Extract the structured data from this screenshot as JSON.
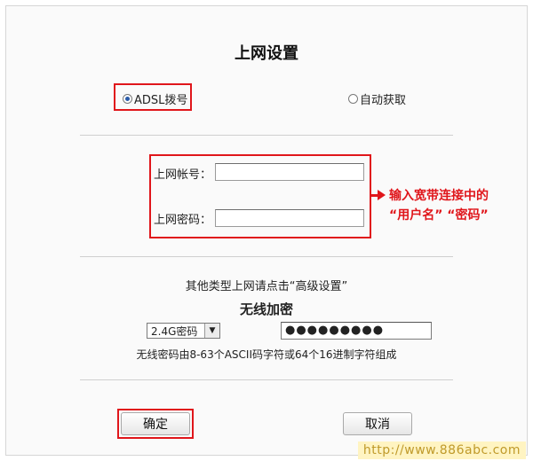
{
  "title": "上网设置",
  "mode": {
    "options": [
      {
        "label": "ADSL拨号",
        "selected": true
      },
      {
        "label": "自动获取",
        "selected": false
      }
    ]
  },
  "account": {
    "username_label": "上网帐号：",
    "username_value": "",
    "password_label": "上网密码：",
    "password_value": ""
  },
  "annotation": {
    "line1": "输入宽带连接中的",
    "line2": "“用户名” “密码”"
  },
  "advanced_hint": "其他类型上网请点击“高级设置”",
  "wireless": {
    "title": "无线加密",
    "band_selected": "2.4G密码",
    "password_value": "●●●●●●●●●",
    "hint": "无线密码由8-63个ASCII码字符或64个16进制字符组成"
  },
  "buttons": {
    "confirm": "确定",
    "cancel": "取消"
  },
  "watermark": "http://www.886abc.com",
  "colors": {
    "highlight_red": "#e0161b",
    "radio_selected": "#2a5aa8"
  }
}
